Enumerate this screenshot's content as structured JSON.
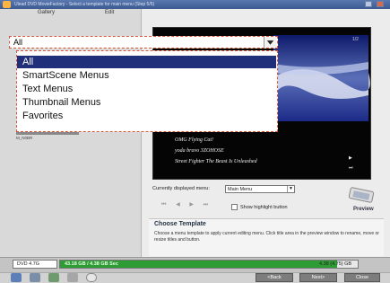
{
  "window": {
    "title": "Ulead DVD MovieFactory - Select a template for main menu (Step 5/5)"
  },
  "tabs": [
    {
      "label": "Gallery"
    },
    {
      "label": "Edit"
    }
  ],
  "gallery_filter": {
    "value": "All",
    "options": [
      {
        "label": "All",
        "selected": true
      },
      {
        "label": "SmartScene Menus"
      },
      {
        "label": "Text Menus"
      },
      {
        "label": "Thumbnail Menus"
      },
      {
        "label": "Favorites"
      }
    ]
  },
  "thumbnail_caption": "M_N0BR",
  "preview": {
    "page_label": "1/2",
    "items": [
      "OMG Flying Cat!",
      "yoda bravo 3ZOHOSE",
      "Street Fighter  The Beast Is Unleashed"
    ],
    "label": "Preview"
  },
  "menu_control": {
    "label": "Currently displayed menu:",
    "value": "Main Menu"
  },
  "playback_controls": {
    "first": "⏮",
    "prev": "◀",
    "next": "▶",
    "last": "⏭"
  },
  "show_highlight": {
    "label": "Show highlight button"
  },
  "template_info": {
    "title": "Choose Template",
    "description": "Choose a menu template to apply current editing menu. Click title area in the preview window to rename, move or resize titles and button."
  },
  "capacity": {
    "disc_type": "DVD 4.7G",
    "used_text": "43.18 GB / 4.38 GB Sec",
    "fill_fraction": 0.93,
    "total": "4.38 (4.75) GB"
  },
  "navigation": {
    "back": "<Back",
    "next": "Next>",
    "close": "Close"
  },
  "colors": {
    "accent": "#1f2f7a",
    "progress": "#2e9c34",
    "dashed_border": "#d9553a"
  }
}
